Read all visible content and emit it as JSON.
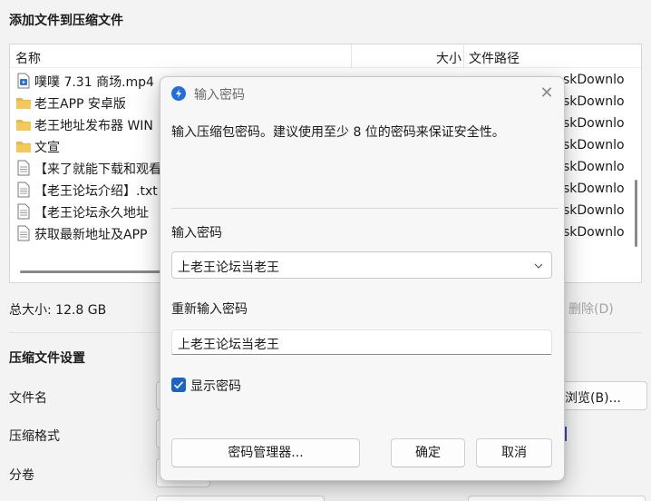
{
  "window": {
    "title": "添加文件到压缩文件"
  },
  "file_list": {
    "columns": {
      "name": "名称",
      "size": "大小",
      "path": "文件路径"
    },
    "rows": [
      {
        "name": "噗噗 7.31 商场.mp4",
        "icon": "video-file-icon",
        "path": "skDownlo"
      },
      {
        "name": "老王APP 安卓版",
        "icon": "folder-icon",
        "path": "skDownlo"
      },
      {
        "name": "老王地址发布器 WIN",
        "icon": "folder-icon",
        "path": "skDownlo"
      },
      {
        "name": "文宣",
        "icon": "folder-icon",
        "path": "skDownlo"
      },
      {
        "name": "【来了就能下载和观看",
        "icon": "document-icon",
        "path": "skDownlo"
      },
      {
        "name": "【老王论坛介绍】.txt",
        "icon": "document-icon",
        "path": "skDownlo"
      },
      {
        "name": "【老王论坛永久地址",
        "icon": "document-icon",
        "path": "skDownlo"
      },
      {
        "name": "获取最新地址及APP",
        "icon": "document-icon",
        "path": "skDownlo"
      }
    ]
  },
  "total_size": "总大小: 12.8 GB",
  "delete_label": "删除(D)",
  "settings": {
    "title": "压缩文件设置",
    "filename_label": "文件名",
    "format_label": "压缩格式",
    "split_label": "分卷",
    "browse_label": "浏览(B)..."
  },
  "dialog": {
    "title": "输入密码",
    "description": "输入压缩包密码。建议使用至少 8 位的密码来保证安全性。",
    "password_label": "输入密码",
    "password_value": "上老王论坛当老王",
    "reenter_label": "重新输入密码",
    "reenter_value": "上老王论坛当老王",
    "show_password_label": "显示密码",
    "show_password_checked": true,
    "manager_button": "密码管理器...",
    "ok_button": "确定",
    "cancel_button": "取消"
  },
  "colors": {
    "accent": "#1a63c7",
    "folder": "#e8b84a"
  }
}
